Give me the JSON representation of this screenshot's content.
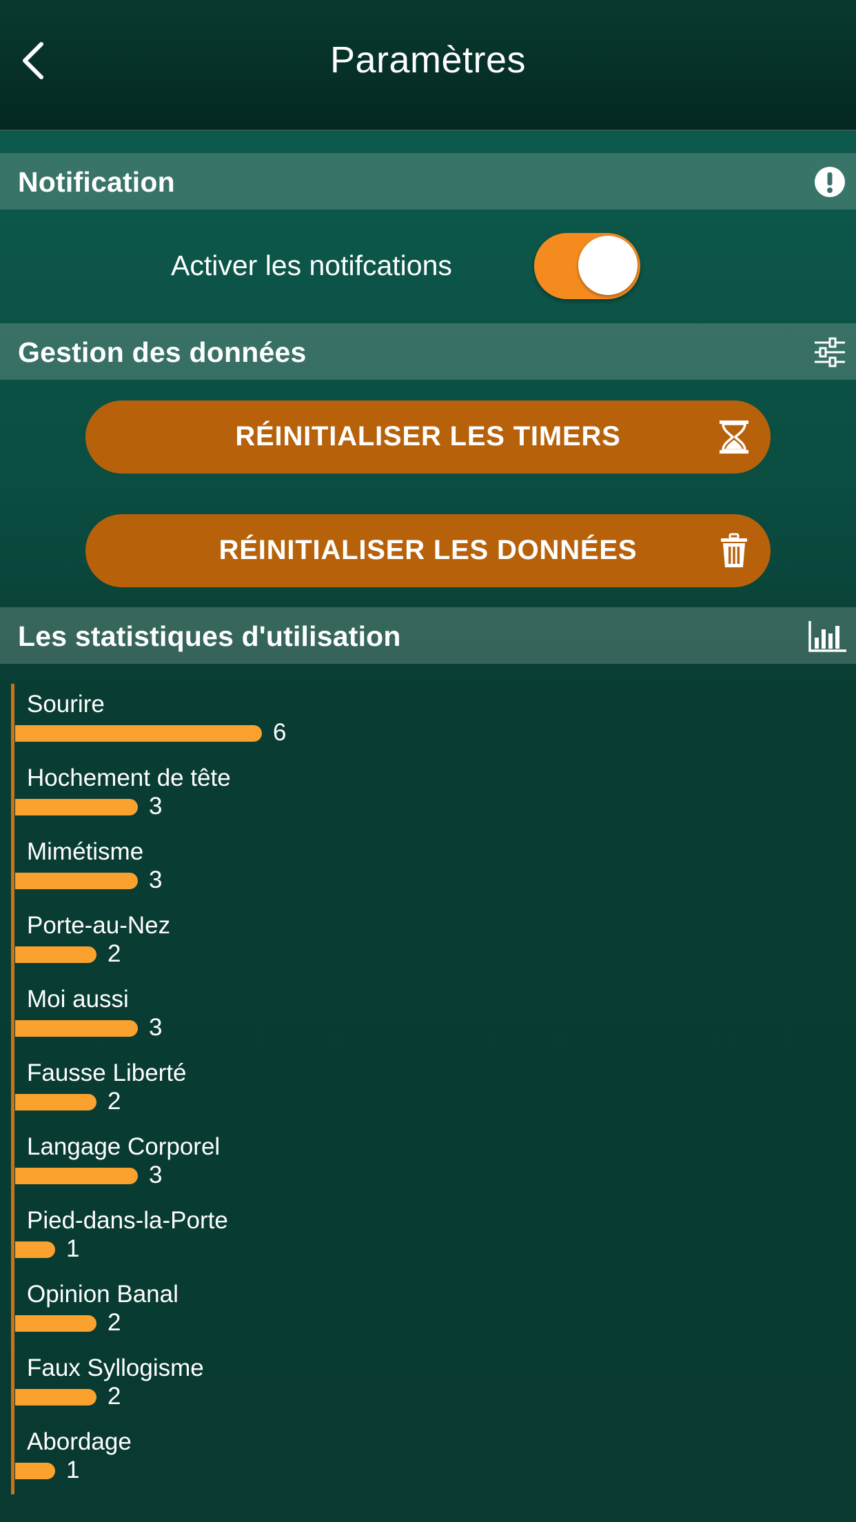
{
  "header": {
    "title": "Paramètres",
    "back_icon": "chevron-left-icon"
  },
  "notification": {
    "title": "Notification",
    "icon": "exclamation-circle-icon",
    "toggle_label": "Activer les notifcations",
    "toggle_on": true,
    "accent_color": "#f58a1f"
  },
  "data_management": {
    "title": "Gestion des données",
    "icon": "sliders-icon",
    "reset_timers_label": "RÉINITIALISER LES TIMERS",
    "reset_timers_icon": "hourglass-icon",
    "reset_data_label": "RÉINITIALISER LES DONNÉES",
    "reset_data_icon": "trash-icon",
    "button_color": "#b7620b"
  },
  "stats": {
    "title": "Les statistiques d'utilisation",
    "icon": "bar-chart-icon"
  },
  "chart_data": {
    "type": "bar",
    "orientation": "horizontal",
    "categories": [
      "Sourire",
      "Hochement de tête",
      "Mimétisme",
      "Porte-au-Nez",
      "Moi aussi",
      "Fausse Liberté",
      "Langage Corporel",
      "Pied-dans-la-Porte",
      "Opinion Banal",
      "Faux Syllogisme",
      "Abordage"
    ],
    "values": [
      6,
      3,
      3,
      2,
      3,
      2,
      3,
      1,
      2,
      2,
      1
    ],
    "bar_color": "#fba22e",
    "axis_color": "#c8731e",
    "data_labels": true
  }
}
